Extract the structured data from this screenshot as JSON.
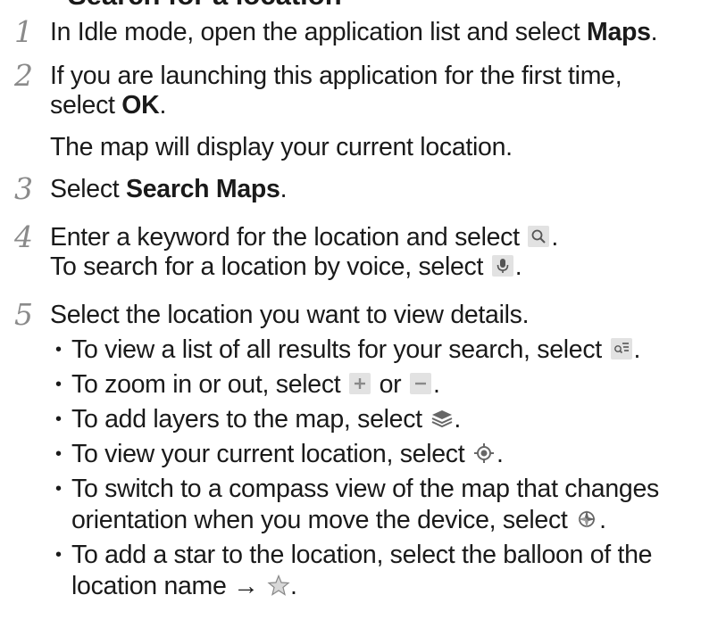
{
  "heading": "Search for a location",
  "steps": [
    {
      "num": "1",
      "pre": "In Idle mode, open the application list and select ",
      "bold": "Maps",
      "post": "."
    },
    {
      "num": "2",
      "l1": "If you are launching this application for the first time,",
      "l2_pre": "select ",
      "l2_bold": "OK",
      "l2_post": ".",
      "l3": "The map will display your current location."
    },
    {
      "num": "3",
      "pre": "Select ",
      "bold": "Search Maps",
      "post": "."
    },
    {
      "num": "4",
      "l1_pre": "Enter a keyword for the location and select ",
      "l1_post": ".",
      "l2_pre": "To search for a location by voice, select ",
      "l2_post": "."
    },
    {
      "num": "5",
      "l1": "Select the location you want to view details."
    }
  ],
  "bullets": [
    {
      "pre": "To view a list of all results for your search, select ",
      "post": "."
    },
    {
      "pre": "To zoom in or out, select ",
      "mid": " or ",
      "post": "."
    },
    {
      "pre": "To add layers to the map, select ",
      "post": "."
    },
    {
      "pre": "To view your current location, select ",
      "post": "."
    },
    {
      "l1": "To switch to a compass view of the map that changes",
      "l2_pre": "orientation when you move the device, select ",
      "l2_post": "."
    },
    {
      "l1": "To add a star to the location, select the balloon of the",
      "l2_pre": "location name → ",
      "l2_post": "."
    }
  ],
  "bullet_char": "•",
  "icons": {
    "search": "search-icon",
    "voice": "microphone-icon",
    "list": "results-list-icon",
    "zoom_in": "zoom-in-icon",
    "zoom_out": "zoom-out-icon",
    "layers": "layers-icon",
    "my_location": "my-location-icon",
    "compass": "compass-icon",
    "star": "star-icon"
  },
  "colors": {
    "text": "#1a1a1a",
    "step_number": "#8a8a8a",
    "icon_bg": "#e2e2e2",
    "icon_fg": "#555555"
  }
}
